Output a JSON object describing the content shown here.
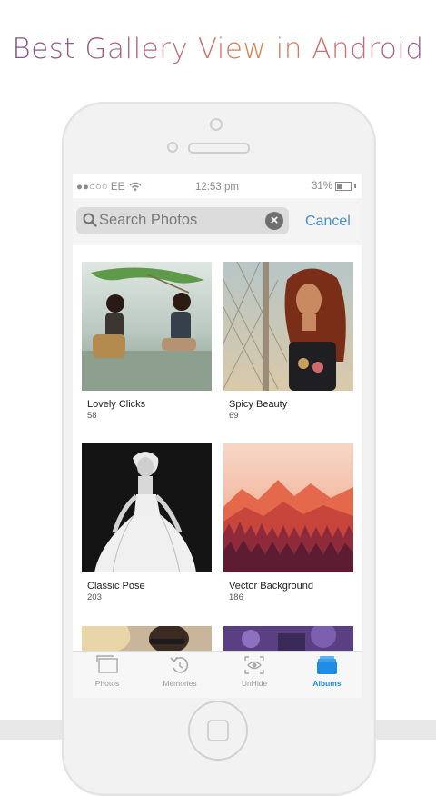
{
  "headline": "Best Gallery View in Android",
  "status": {
    "carrier": "●●○○○ EE",
    "time": "12:53 pm",
    "battery": "31%"
  },
  "search": {
    "placeholder": "Search Photos",
    "cancel": "Cancel"
  },
  "albums": [
    {
      "title": "Lovely Clicks",
      "count": "58"
    },
    {
      "title": "Spicy Beauty",
      "count": "69"
    },
    {
      "title": "Classic Pose",
      "count": "203"
    },
    {
      "title": "Vector Background",
      "count": "186"
    }
  ],
  "tabs": [
    {
      "label": "Photos",
      "icon": "photos-icon"
    },
    {
      "label": "Memories",
      "icon": "memories-icon"
    },
    {
      "label": "UnHide",
      "icon": "unhide-icon"
    },
    {
      "label": "Albums",
      "icon": "albums-icon",
      "active": true
    }
  ],
  "colors": {
    "accent": "#1d8de6",
    "cancel": "#4a90c8"
  }
}
